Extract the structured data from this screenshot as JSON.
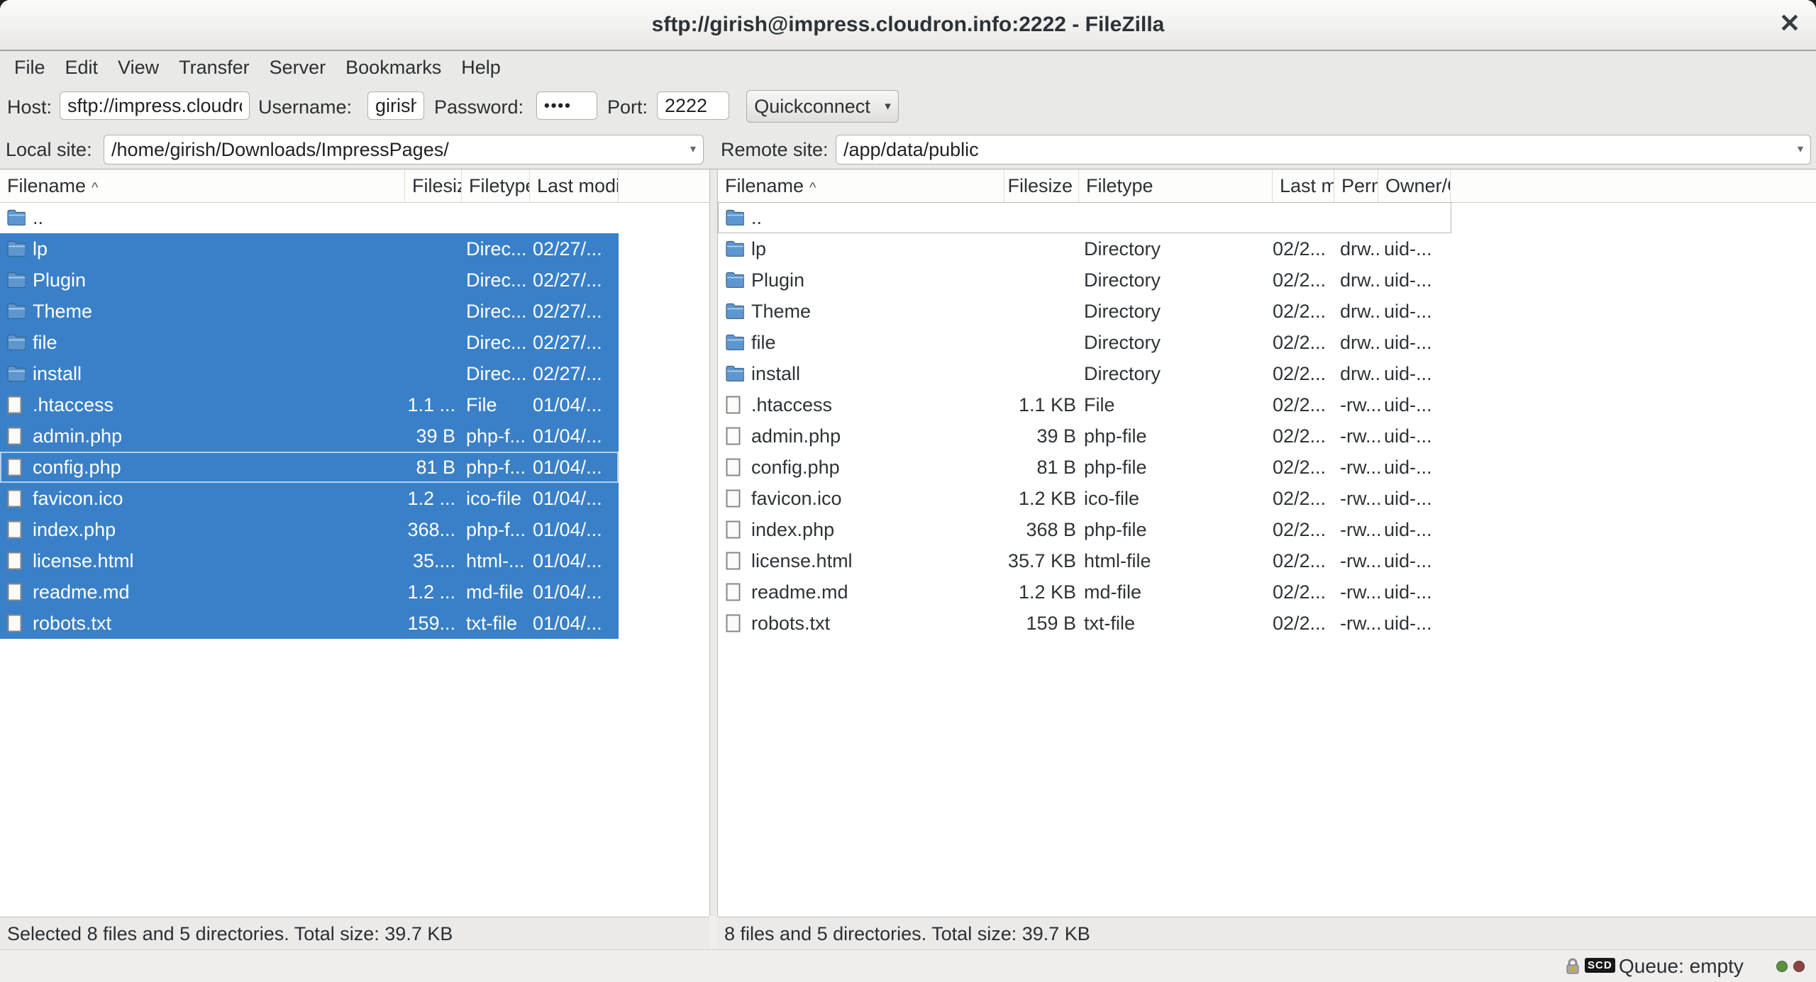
{
  "window": {
    "title": "sftp://girish@impress.cloudron.info:2222 - FileZilla"
  },
  "icons": {
    "close": "✕",
    "dropdown": "▾",
    "sort_asc": "^"
  },
  "menu": {
    "items": [
      "File",
      "Edit",
      "View",
      "Transfer",
      "Server",
      "Bookmarks",
      "Help"
    ]
  },
  "quickconnect": {
    "host_label": "Host:",
    "host_value": "sftp://impress.cloudron.info",
    "username_label": "Username:",
    "username_value": "girish",
    "password_label": "Password:",
    "password_value": "••••",
    "port_label": "Port:",
    "port_value": "2222",
    "button_label": "Quickconnect"
  },
  "local_panel": {
    "site_label": "Local site:",
    "site_value": "/home/girish/Downloads/ImpressPages/",
    "columns": [
      "Filename",
      "Filesize",
      "Filetype",
      "Last modified"
    ],
    "rows": [
      {
        "name": "..",
        "kind": "up",
        "size": "",
        "type": "",
        "modified": "",
        "selected": false
      },
      {
        "name": "lp",
        "kind": "dir",
        "size": "",
        "type": "Direc...",
        "modified": "02/27/...",
        "selected": true
      },
      {
        "name": "Plugin",
        "kind": "dir",
        "size": "",
        "type": "Direc...",
        "modified": "02/27/...",
        "selected": true
      },
      {
        "name": "Theme",
        "kind": "dir",
        "size": "",
        "type": "Direc...",
        "modified": "02/27/...",
        "selected": true
      },
      {
        "name": "file",
        "kind": "dir",
        "size": "",
        "type": "Direc...",
        "modified": "02/27/...",
        "selected": true
      },
      {
        "name": "install",
        "kind": "dir",
        "size": "",
        "type": "Direc...",
        "modified": "02/27/...",
        "selected": true
      },
      {
        "name": ".htaccess",
        "kind": "file",
        "size": "1.1 ...",
        "type": "File",
        "modified": "01/04/...",
        "selected": true
      },
      {
        "name": "admin.php",
        "kind": "file",
        "size": "39 B",
        "type": "php-f...",
        "modified": "01/04/...",
        "selected": true
      },
      {
        "name": "config.php",
        "kind": "file",
        "size": "81 B",
        "type": "php-f...",
        "modified": "01/04/...",
        "selected": true,
        "focused": true
      },
      {
        "name": "favicon.ico",
        "kind": "file",
        "size": "1.2 ...",
        "type": "ico-file",
        "modified": "01/04/...",
        "selected": true
      },
      {
        "name": "index.php",
        "kind": "file",
        "size": "368...",
        "type": "php-f...",
        "modified": "01/04/...",
        "selected": true
      },
      {
        "name": "license.html",
        "kind": "file",
        "size": "35....",
        "type": "html-...",
        "modified": "01/04/...",
        "selected": true
      },
      {
        "name": "readme.md",
        "kind": "file",
        "size": "1.2 ...",
        "type": "md-file",
        "modified": "01/04/...",
        "selected": true
      },
      {
        "name": "robots.txt",
        "kind": "file",
        "size": "159...",
        "type": "txt-file",
        "modified": "01/04/...",
        "selected": true
      }
    ],
    "status": "Selected 8 files and 5 directories. Total size: 39.7 KB"
  },
  "remote_panel": {
    "site_label": "Remote site:",
    "site_value": "/app/data/public",
    "columns": [
      "Filename",
      "Filesize",
      "Filetype",
      "Last modified",
      "Permissions",
      "Owner/Group"
    ],
    "rows": [
      {
        "name": "..",
        "kind": "up",
        "size": "",
        "type": "",
        "modified": "",
        "perms": "",
        "owner": "",
        "focused": true
      },
      {
        "name": "lp",
        "kind": "dir",
        "size": "",
        "type": "Directory",
        "modified": "02/2...",
        "perms": "drw...",
        "owner": "uid-..."
      },
      {
        "name": "Plugin",
        "kind": "dir",
        "size": "",
        "type": "Directory",
        "modified": "02/2...",
        "perms": "drw...",
        "owner": "uid-..."
      },
      {
        "name": "Theme",
        "kind": "dir",
        "size": "",
        "type": "Directory",
        "modified": "02/2...",
        "perms": "drw...",
        "owner": "uid-..."
      },
      {
        "name": "file",
        "kind": "dir",
        "size": "",
        "type": "Directory",
        "modified": "02/2...",
        "perms": "drw...",
        "owner": "uid-..."
      },
      {
        "name": "install",
        "kind": "dir",
        "size": "",
        "type": "Directory",
        "modified": "02/2...",
        "perms": "drw...",
        "owner": "uid-..."
      },
      {
        "name": ".htaccess",
        "kind": "file",
        "size": "1.1 KB",
        "type": "File",
        "modified": "02/2...",
        "perms": "-rw...",
        "owner": "uid-..."
      },
      {
        "name": "admin.php",
        "kind": "file",
        "size": "39 B",
        "type": "php-file",
        "modified": "02/2...",
        "perms": "-rw...",
        "owner": "uid-..."
      },
      {
        "name": "config.php",
        "kind": "file",
        "size": "81 B",
        "type": "php-file",
        "modified": "02/2...",
        "perms": "-rw...",
        "owner": "uid-..."
      },
      {
        "name": "favicon.ico",
        "kind": "file",
        "size": "1.2 KB",
        "type": "ico-file",
        "modified": "02/2...",
        "perms": "-rw...",
        "owner": "uid-..."
      },
      {
        "name": "index.php",
        "kind": "file",
        "size": "368 B",
        "type": "php-file",
        "modified": "02/2...",
        "perms": "-rw...",
        "owner": "uid-..."
      },
      {
        "name": "license.html",
        "kind": "file",
        "size": "35.7 KB",
        "type": "html-file",
        "modified": "02/2...",
        "perms": "-rw...",
        "owner": "uid-..."
      },
      {
        "name": "readme.md",
        "kind": "file",
        "size": "1.2 KB",
        "type": "md-file",
        "modified": "02/2...",
        "perms": "-rw...",
        "owner": "uid-..."
      },
      {
        "name": "robots.txt",
        "kind": "file",
        "size": "159 B",
        "type": "txt-file",
        "modified": "02/2...",
        "perms": "-rw...",
        "owner": "uid-..."
      }
    ],
    "status": "8 files and 5 directories. Total size: 39.7 KB"
  },
  "statusbar": {
    "queue_label": "Queue: empty",
    "scd_badge": "SCD"
  },
  "colors": {
    "selection_blue": "#3a80c8",
    "queue_dot_green": "#5c8f41",
    "queue_dot_red": "#8e4444"
  }
}
